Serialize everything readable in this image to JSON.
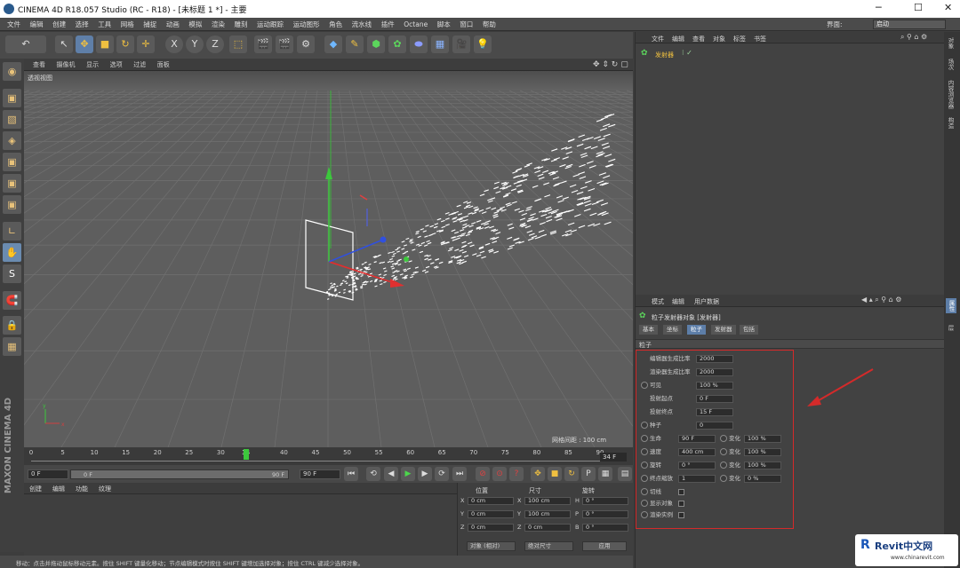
{
  "app": {
    "title": "CINEMA 4D R18.057 Studio (RC - R18) - [未标题 1 *] - 主要",
    "layout_label": "界面:",
    "layout_value": "启动"
  },
  "menubar": [
    "文件",
    "编辑",
    "创建",
    "选择",
    "工具",
    "网格",
    "捕捉",
    "动画",
    "模拟",
    "渲染",
    "雕刻",
    "运动跟踪",
    "运动图形",
    "角色",
    "流水线",
    "插件",
    "Octane",
    "脚本",
    "窗口",
    "帮助"
  ],
  "viewport": {
    "menu": [
      "查看",
      "摄像机",
      "显示",
      "选项",
      "过滤",
      "面板"
    ],
    "label": "透视视图",
    "grid_spacing": "网格间距 : 100 cm"
  },
  "timeline": {
    "ticks": [
      "0",
      "5",
      "10",
      "15",
      "20",
      "25",
      "30",
      "34",
      "40",
      "45",
      "50",
      "55",
      "60",
      "65",
      "70",
      "75",
      "80",
      "85",
      "90"
    ],
    "current_frame": "34 F",
    "current_tick": 34,
    "frame_max": 90
  },
  "transport": {
    "start": "0 F",
    "range_start": "0 F",
    "range_end": "90 F",
    "end": "90 F"
  },
  "bottom_panel": {
    "tabs": [
      "创建",
      "编辑",
      "功能",
      "纹理"
    ]
  },
  "coords": {
    "headers": [
      "位置",
      "尺寸",
      "旋转"
    ],
    "rows": [
      {
        "axis": "X",
        "pos": "0 cm",
        "size_axis": "X",
        "size": "100 cm",
        "rot_axis": "H",
        "rot": "0 °"
      },
      {
        "axis": "Y",
        "pos": "0 cm",
        "size_axis": "Y",
        "size": "100 cm",
        "rot_axis": "P",
        "rot": "0 °"
      },
      {
        "axis": "Z",
        "pos": "0 cm",
        "size_axis": "Z",
        "size": "0 cm",
        "rot_axis": "B",
        "rot": "0 °"
      }
    ],
    "mode_left": "对象 (相对)",
    "mode_mid": "绝对尺寸",
    "apply": "应用"
  },
  "statusbar": "移动：点击并拖动鼠标移动元素。按住 SHIFT 键量化移动；节点编辑模式时按住 SHIFT 键增加选择对象；按住 CTRL 键减少选择对象。",
  "object_manager": {
    "menu": [
      "文件",
      "编辑",
      "查看",
      "对象",
      "标签",
      "书签"
    ],
    "object_name": "发射器"
  },
  "attribute_manager": {
    "menu": [
      "模式",
      "编辑",
      "用户数据"
    ],
    "object_title": "粒子发射器对象 [发射器]",
    "tabs": [
      "基本",
      "坐标",
      "粒子",
      "发射器",
      "包括"
    ],
    "active_tab": 2,
    "section": "粒子",
    "fields": [
      {
        "label": "编辑器生成比率",
        "value": "2000"
      },
      {
        "label": "渲染器生成比率",
        "value": "2000"
      },
      {
        "label": "可见",
        "value": "100 %"
      },
      {
        "label": "投射起点",
        "value": "0 F"
      },
      {
        "label": "投射终点",
        "value": "15 F"
      },
      {
        "label": "种子",
        "value": "0"
      }
    ],
    "var_rows": [
      {
        "label": "生命",
        "value": "90 F",
        "var_label": "变化",
        "var": "100 %"
      },
      {
        "label": "速度",
        "value": "400 cm",
        "var_label": "变化",
        "var": "100 %"
      },
      {
        "label": "旋转",
        "value": "0 °",
        "var_label": "变化",
        "var": "100 %"
      },
      {
        "label": "终点缩放",
        "value": "1",
        "var_label": "变化",
        "var": "0 %"
      }
    ],
    "checks": [
      "切线",
      "显示对象",
      "渲染实例"
    ]
  },
  "right_strip": [
    "对象",
    "场次",
    "内容浏览器",
    "构造",
    "属性",
    "层"
  ],
  "watermark": {
    "brand": "Revit中文网",
    "url": "www.chinarevit.com"
  },
  "maxon": "MAXON CINEMA 4D"
}
